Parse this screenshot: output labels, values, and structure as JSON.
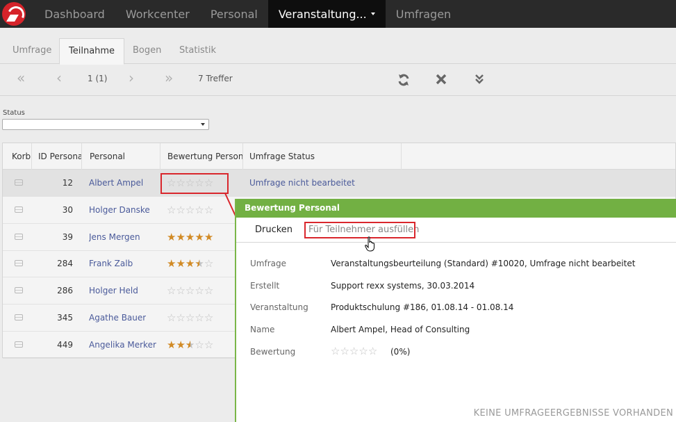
{
  "nav": {
    "items": [
      {
        "label": "Dashboard"
      },
      {
        "label": "Workcenter"
      },
      {
        "label": "Personal"
      },
      {
        "label": "Veranstaltung..."
      },
      {
        "label": "Umfragen"
      }
    ]
  },
  "tabs": [
    {
      "label": "Umfrage"
    },
    {
      "label": "Teilnahme"
    },
    {
      "label": "Bogen"
    },
    {
      "label": "Statistik"
    }
  ],
  "toolbar": {
    "first": "«",
    "prev": "‹",
    "page": "1 (1)",
    "next": "›",
    "last": "»",
    "count": "7 Treffer"
  },
  "filter": {
    "label": "Status",
    "value": ""
  },
  "table": {
    "columns": [
      "Korb",
      "ID Personal",
      "Personal",
      "Bewertung Personal",
      "Umfrage Status"
    ],
    "rows": [
      {
        "id": "12",
        "name": "Albert Ampel",
        "rating": 0,
        "status": "Umfrage nicht bearbeitet"
      },
      {
        "id": "30",
        "name": "Holger Danske",
        "rating": 0,
        "status": ""
      },
      {
        "id": "39",
        "name": "Jens Mergen",
        "rating": 5,
        "status": ""
      },
      {
        "id": "284",
        "name": "Frank Zalb",
        "rating": 3.5,
        "status": ""
      },
      {
        "id": "286",
        "name": "Holger Held",
        "rating": 0,
        "status": ""
      },
      {
        "id": "345",
        "name": "Agathe Bauer",
        "rating": 0,
        "status": ""
      },
      {
        "id": "449",
        "name": "Angelika Merker",
        "rating": 2.5,
        "status": ""
      }
    ]
  },
  "popup": {
    "title": "Bewertung Personal",
    "tab_print": "Drucken",
    "tab_fill": "Für Teilnehmer ausfüllen",
    "fields": [
      {
        "label": "Umfrage",
        "value": "Veranstaltungsbeurteilung (Standard) #10020, Umfrage nicht bearbeitet"
      },
      {
        "label": "Erstellt",
        "value": "Support rexx systems, 30.03.2014"
      },
      {
        "label": "Veranstaltung",
        "value": "Produktschulung #186, 01.08.14 - 01.08.14"
      },
      {
        "label": "Name",
        "value": "Albert Ampel, Head of Consulting"
      },
      {
        "label": "Bewertung",
        "value": "(0%)"
      }
    ],
    "rating": 0,
    "no_results": "KEINE UMFRAGEERGEBNISSE VORHANDEN"
  },
  "colors": {
    "accent_green": "#72b043",
    "highlight_red": "#d9262c",
    "star_gold": "#d18a24",
    "link_blue": "#4a5a9a"
  }
}
